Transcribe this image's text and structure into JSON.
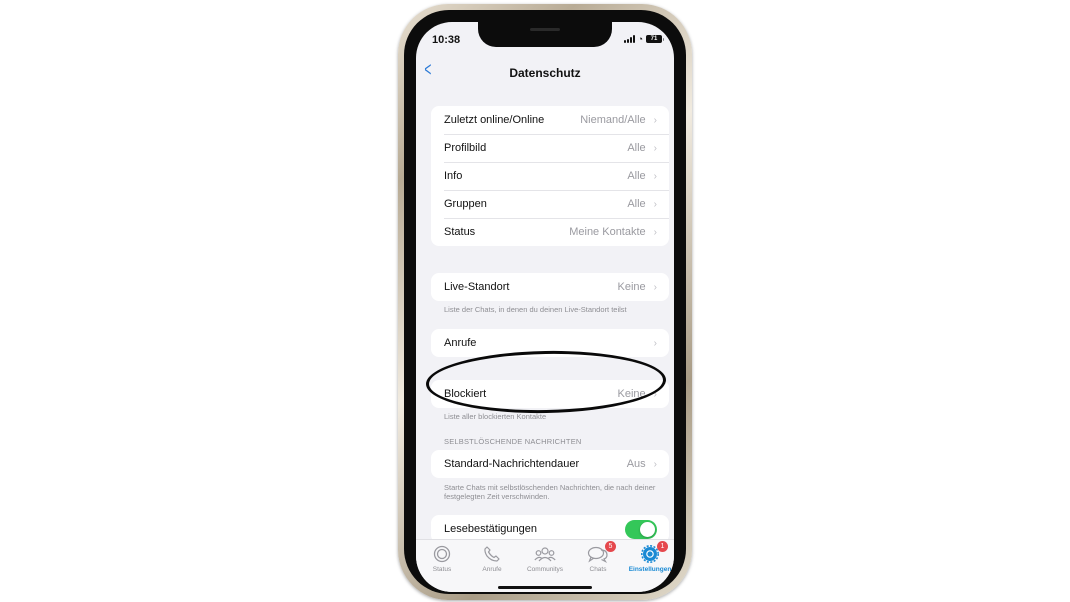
{
  "status_bar": {
    "time": "10:38",
    "battery": "71"
  },
  "nav": {
    "back_icon": "chevron-left-icon",
    "title": "Datenschutz"
  },
  "groups": {
    "privacy": [
      {
        "label": "Zuletzt online/Online",
        "value": "Niemand/Alle"
      },
      {
        "label": "Profilbild",
        "value": "Alle"
      },
      {
        "label": "Info",
        "value": "Alle"
      },
      {
        "label": "Gruppen",
        "value": "Alle"
      },
      {
        "label": "Status",
        "value": "Meine Kontakte"
      }
    ],
    "live_location": {
      "label": "Live-Standort",
      "value": "Keine",
      "footnote": "Liste der Chats, in denen du deinen Live-Standort teilst"
    },
    "calls": {
      "label": "Anrufe",
      "value": ""
    },
    "blocked": {
      "label": "Blockiert",
      "value": "Keine",
      "footnote": "Liste aller blockierten Kontakte"
    },
    "disappearing": {
      "header": "SELBSTLÖSCHENDE NACHRICHTEN",
      "label": "Standard-Nachrichtendauer",
      "value": "Aus",
      "footnote": "Starte Chats mit selbstlöschenden Nachrichten, die nach deiner festgelegten Zeit verschwinden."
    },
    "read_receipts": {
      "label": "Lesebestätigungen",
      "enabled": true
    }
  },
  "chevron": "›",
  "tabbar": {
    "tabs": [
      {
        "label": "Status",
        "icon": "status-icon",
        "badge": null
      },
      {
        "label": "Anrufe",
        "icon": "phone-icon",
        "badge": null
      },
      {
        "label": "Communitys",
        "icon": "communities-icon",
        "badge": null
      },
      {
        "label": "Chats",
        "icon": "chat-bubbles-icon",
        "badge": "5"
      },
      {
        "label": "Einstellungen",
        "icon": "settings-gear-icon",
        "badge": "1",
        "active": true
      }
    ]
  },
  "colors": {
    "accent": "#1a8ad4",
    "toggle_on": "#34c759",
    "badge": "#e5484d",
    "background": "#f2f2f6"
  }
}
